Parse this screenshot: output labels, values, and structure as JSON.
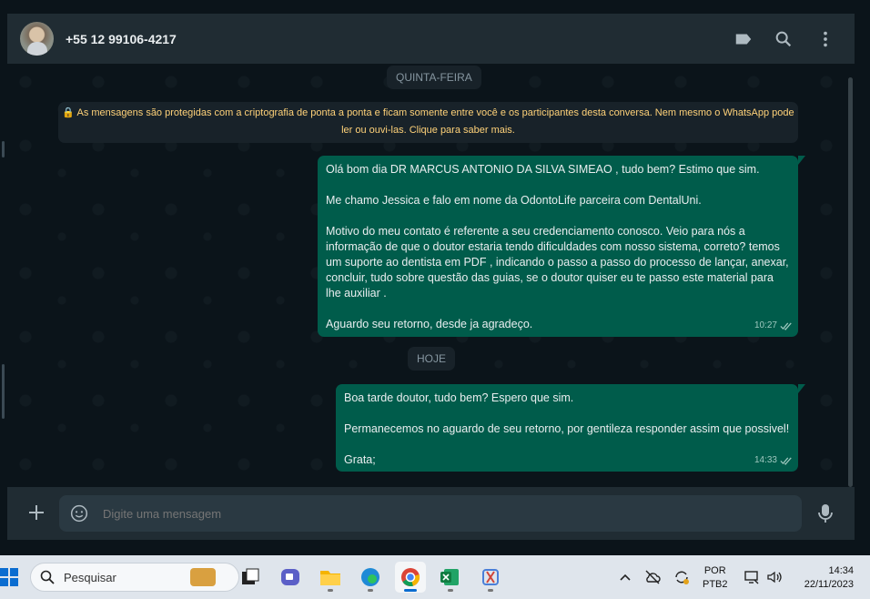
{
  "contact": {
    "name": "+55 12 99106-4217"
  },
  "header_icons": [
    "label-icon",
    "search-icon",
    "menu-dots-icon"
  ],
  "chat": {
    "date_1": "QUINTA-FEIRA",
    "encryption_notice": "As mensagens são protegidas com a criptografia de ponta a ponta e ficam somente entre você e os participantes desta conversa. Nem mesmo o WhatsApp pode ler ou ouvi-las. Clique para saber mais.",
    "message_1": {
      "paragraphs": [
        "Olá bom dia DR MARCUS ANTONIO DA SILVA SIMEAO , tudo bem? Estimo que sim.",
        "Me chamo Jessica e falo em nome da OdontoLife parceira com DentalUni.",
        "Motivo do meu contato é referente a seu credenciamento conosco. Veio para nós a informação de que o doutor estaria tendo dificuldades com nosso sistema, correto? temos um suporte ao dentista em PDF , indicando o passo a passo do processo de lançar, anexar, concluir, tudo sobre questão das guias, se o doutor quiser eu te passo este material para lhe auxiliar .",
        "Aguardo seu retorno, desde ja agradeço."
      ],
      "time": "10:27"
    },
    "date_2": "HOJE",
    "message_2": {
      "paragraphs": [
        "Boa tarde doutor, tudo bem? Espero que sim.",
        "Permanecemos no aguardo de seu retorno, por gentileza responder assim que possivel!",
        "Grata;"
      ],
      "time": "14:33"
    }
  },
  "composer": {
    "placeholder": "Digite uma mensagem"
  },
  "taskbar": {
    "search_label": "Pesquisar",
    "language": "POR",
    "keyboard": "PTB2",
    "time": "14:34",
    "date": "22/11/2023"
  },
  "colors": {
    "header": "#202c33",
    "bubble_out": "#005c4b",
    "background": "#0b141a",
    "notice": "#ffd279"
  }
}
